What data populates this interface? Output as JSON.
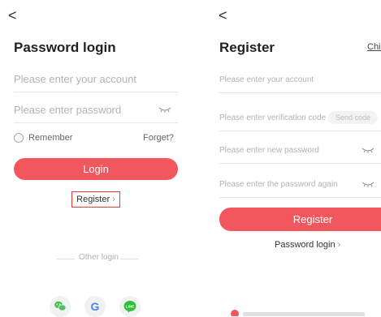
{
  "left": {
    "back_glyph": "<",
    "title": "Password login",
    "account_placeholder": "Please enter your account",
    "password_placeholder": "Please enter password",
    "remember_label": "Remember",
    "forget_label": "Forget?",
    "login_label": "Login",
    "register_link": "Register",
    "chevron": "›",
    "other_login_label": "Other login",
    "social": [
      "wechat-icon",
      "google-icon",
      "line-icon"
    ],
    "google_letter": "G",
    "line_text": "LINE"
  },
  "right": {
    "back_glyph": "<",
    "title": "Register",
    "language": "Chin",
    "account_placeholder": "Please enter your account",
    "code_placeholder": "Please enter verification code",
    "send_code_label": "Send code",
    "new_password_placeholder": "Please enter new password",
    "again_password_placeholder": "Please enter the password again",
    "register_label": "Register",
    "password_login_link": "Password login",
    "chevron": "›"
  },
  "colors": {
    "accent": "#f2575e",
    "highlight_box": "#e53935",
    "wechat": "#4cc35c",
    "line": "#2fbf3a"
  }
}
